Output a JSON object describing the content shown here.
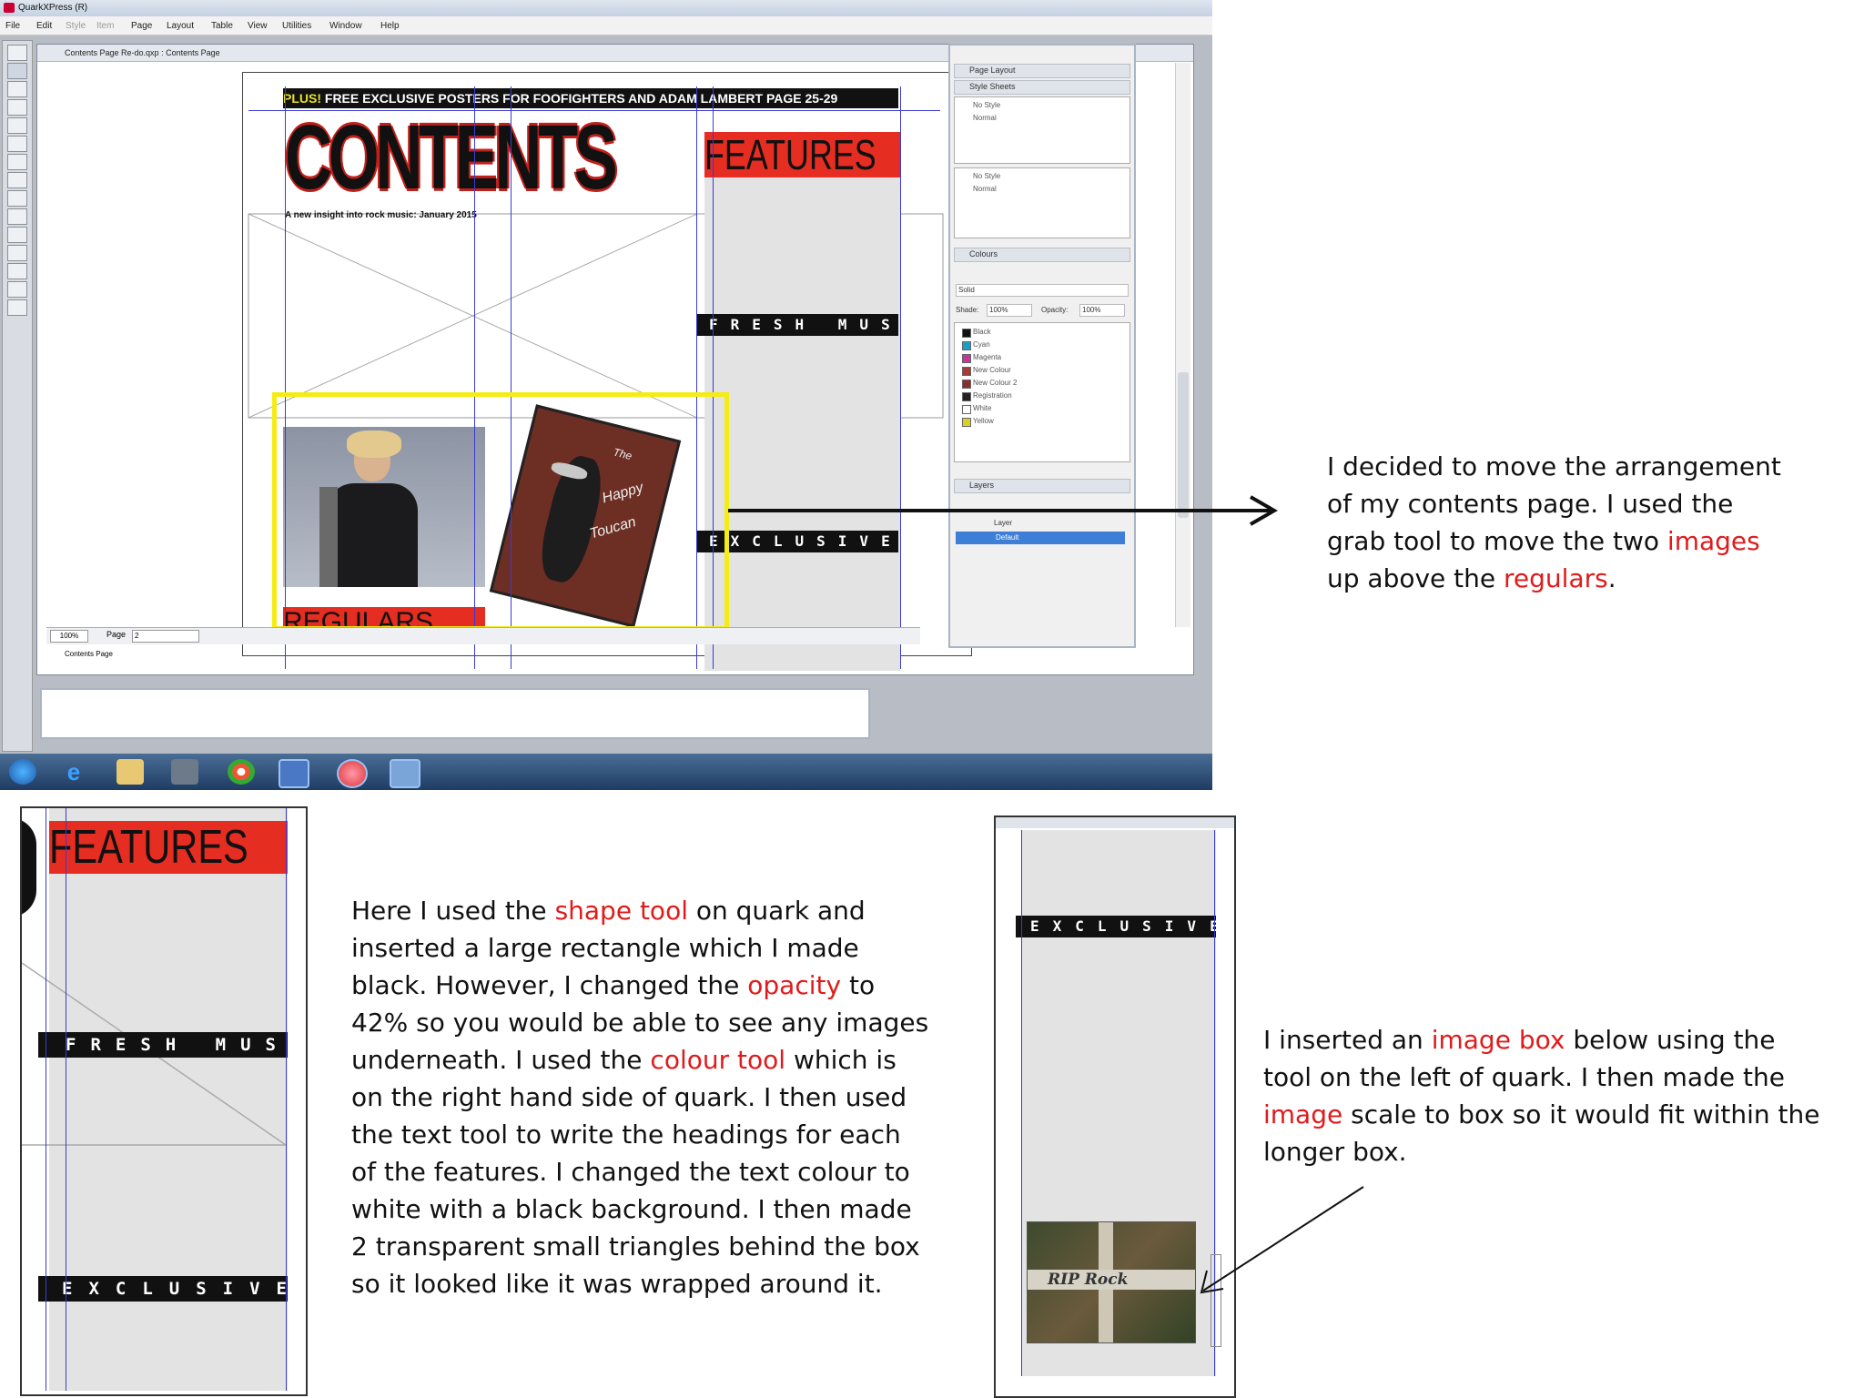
{
  "quark": {
    "app_title": "QuarkXPress (R)",
    "menu": [
      "File",
      "Edit",
      "Style",
      "Item",
      "Page",
      "Layout",
      "Table",
      "View",
      "Utilities",
      "Window",
      "Help"
    ],
    "menu_disabled": [
      "Style",
      "Item"
    ],
    "doc_title": "Contents Page Re-do.qxp : Contents Page",
    "zoom": "100%",
    "page_label": "Page",
    "page_number": "2",
    "layout_tab": "Contents Page",
    "magazine": {
      "banner_plus": "PLUS!",
      "banner_text": "FREE EXCLUSIVE POSTERS FOR FOOFIGHTERS AND ADAM LAMBERT PAGE 25-29",
      "masthead": "CONTENTS",
      "features": "FEATURES",
      "tagline": "A new insight into rock music: January 2015",
      "fresh_music": "FRESH MUSIC",
      "exclusives": "EXCLUSIVES",
      "regulars": "REGULARS",
      "poster_text_1": "The",
      "poster_text_2": "Happy",
      "poster_text_3": "Toucan"
    },
    "panel": {
      "page_layout": "Page Layout",
      "style_sheets": "Style Sheets",
      "para_styles": [
        "No Style",
        "Normal"
      ],
      "char_styles": [
        "No Style",
        "Normal"
      ],
      "colours": "Colours",
      "solid": "Solid",
      "shade_label": "Shade:",
      "shade": "100%",
      "opacity_label": "Opacity:",
      "opacity": "100%",
      "colour_list": [
        {
          "name": "Black",
          "color": "#111111"
        },
        {
          "name": "Cyan",
          "color": "#1aa0c8"
        },
        {
          "name": "Magenta",
          "color": "#c2389a"
        },
        {
          "name": "New Colour",
          "color": "#a83a3a"
        },
        {
          "name": "New Colour 2",
          "color": "#8a2f2f"
        },
        {
          "name": "Registration",
          "color": "#222222"
        },
        {
          "name": "White",
          "color": "#ffffff"
        },
        {
          "name": "Yellow",
          "color": "#d8cf2a"
        }
      ],
      "layers": "Layers",
      "layer_col": "Layer",
      "layer_default": "Default"
    }
  },
  "annotations": {
    "top_right": [
      {
        "text": "I decided to move the arrangement"
      },
      {
        "text": "of my contents page. I used the"
      },
      {
        "text": "grab tool to move the two ",
        "red": "images"
      },
      {
        "text": "up above the ",
        "red": "regulars",
        "tail": "."
      }
    ],
    "middle": [
      {
        "text": "Here I used the ",
        "red": "shape tool",
        "tail": " on quark and"
      },
      {
        "text": "inserted a large rectangle which I made"
      },
      {
        "text": "black. However, I changed the ",
        "red": "opacity",
        "tail": " to"
      },
      {
        "text": "42% so you would be able to see any images"
      },
      {
        "text": "underneath. I used the ",
        "red": "colour tool",
        "tail": " which is"
      },
      {
        "text": "on the right hand side of quark. I then used"
      },
      {
        "text": "the text tool to write the headings for each"
      },
      {
        "text": "of the features. I changed the text colour to"
      },
      {
        "text": "white with a black background. I then made"
      },
      {
        "text": "2 transparent small triangles behind the box"
      },
      {
        "text": "so it looked like it was wrapped around it."
      }
    ],
    "bottom_right": [
      {
        "text": "I inserted an ",
        "red": "image box",
        "tail": " below using the"
      },
      {
        "text": "tool on the left of quark. I then made the"
      },
      {
        "text": "",
        "red": "image",
        "tail": " scale to box so it would fit within the"
      },
      {
        "text": "longer box."
      }
    ]
  },
  "crops": {
    "left": {
      "features": "FEATURES",
      "fresh_music": "FRESH MUSIC",
      "exclusives": "EXCLUSIVES"
    },
    "right": {
      "exclusives": "EXCLUSIVES",
      "image_text": "RIP Rock"
    }
  },
  "colors": {
    "accent_red": "#e01b1b",
    "highlight_yellow": "#f5ec12",
    "feature_red": "#e52d22"
  }
}
